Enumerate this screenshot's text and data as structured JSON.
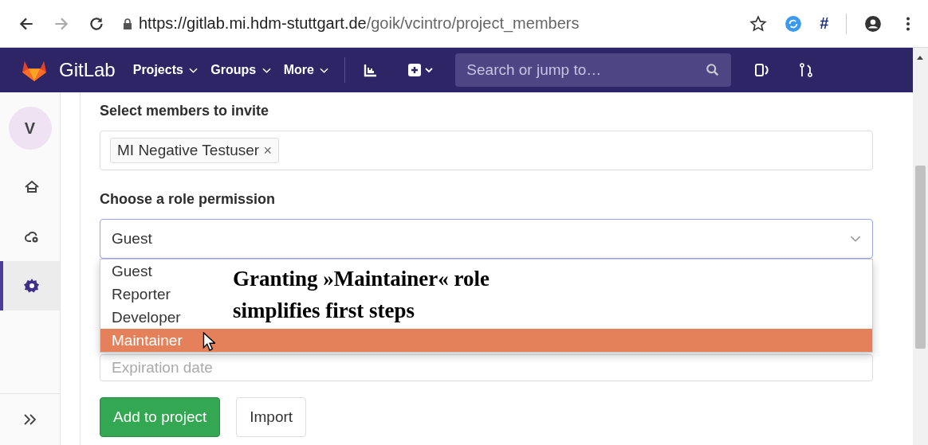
{
  "browser": {
    "url_host": "https://gitlab.mi.hdm-stuttgart.de",
    "url_path": "/goik/vcintro/project_members",
    "extension_label": "#"
  },
  "header": {
    "brand": "GitLab",
    "nav": [
      {
        "label": "Projects"
      },
      {
        "label": "Groups"
      },
      {
        "label": "More"
      }
    ],
    "search": {
      "placeholder": "Search or jump to…"
    }
  },
  "sidebar": {
    "avatar": "V",
    "items": [
      {
        "kind": "home",
        "selected": false
      },
      {
        "kind": "cloud",
        "selected": false
      },
      {
        "kind": "settings",
        "selected": true
      }
    ]
  },
  "form": {
    "members_label": "Select members to invite",
    "members": [
      {
        "label": "MI Negative Testuser",
        "remove": "×"
      }
    ],
    "role_label": "Choose a role permission",
    "role_value": "Guest",
    "role_options": [
      {
        "label": "Guest",
        "selected": false
      },
      {
        "label": "Reporter",
        "selected": false
      },
      {
        "label": "Developer",
        "selected": false
      },
      {
        "label": "Maintainer",
        "selected": true
      }
    ],
    "expiration_placeholder": "Expiration date",
    "buttons": [
      {
        "kind": "primary",
        "label": "Add to project"
      },
      {
        "kind": "default",
        "label": "Import"
      }
    ]
  },
  "annotation": "Granting »Maintainer« role simplifies first steps"
}
